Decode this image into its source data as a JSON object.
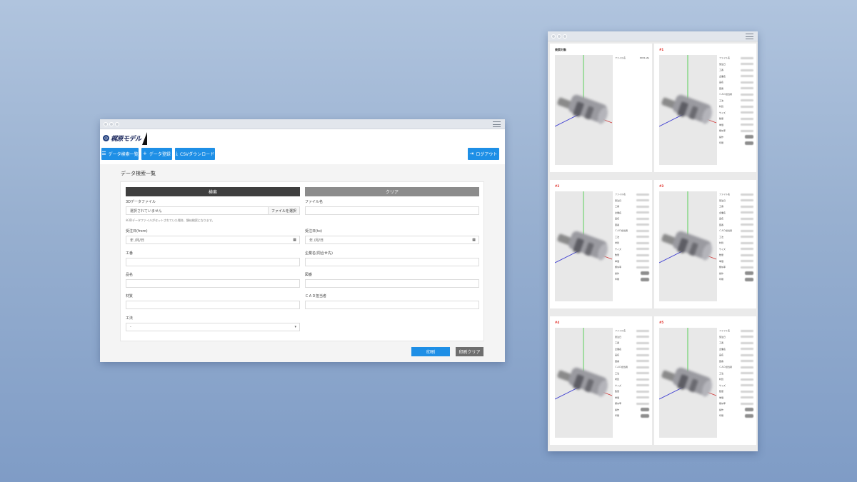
{
  "left_window": {
    "logo_text": "梶原モデル",
    "nav": {
      "list_label": "データ検索一覧",
      "register_label": "データ登録",
      "csv_label": "CSVダウンロード",
      "logout_label": "ログアウト"
    },
    "page_title": "データ検索一覧",
    "search_label": "検索",
    "clear_label": "クリア",
    "fields": {
      "data3d_label": "3Dデータファイル",
      "file_placeholder": "選択されていません",
      "file_button": "ファイルを選択",
      "file_hint": "※3Dデータファイルがセットされていた場合、類似検索になります。",
      "filename_label": "ファイル名",
      "order_date_label": "受注日(from)",
      "order_date_value": "年 /月/日",
      "order_date_to_label": "受注日(to)",
      "order_date_to_value": "年 /月/日",
      "worker_label": "工番",
      "company_label": "企業名(問合せ先)",
      "product_label": "品名",
      "drawing_label": "図番",
      "material_label": "材質",
      "cad_label": "ＣＡＤ担当者",
      "process_label": "工法",
      "process_value": "-"
    },
    "print_label": "印刷",
    "print_clear_label": "印刷クリア"
  },
  "right_window": {
    "cards": [
      {
        "title": "検索対象",
        "red": false,
        "prop_key": "ファイル名",
        "prop_value": "0001.stp"
      },
      {
        "title": "#1",
        "red": true
      },
      {
        "title": "#2",
        "red": true
      },
      {
        "title": "#3",
        "red": true
      },
      {
        "title": "#4",
        "red": true
      },
      {
        "title": "#5",
        "red": true
      }
    ],
    "prop_labels": [
      "ファイル名",
      "受注日",
      "工番",
      "企業名",
      "品名",
      "図番",
      "ＣＡＤ担当者",
      "工法",
      "材質",
      "サイズ",
      "数量",
      "単価",
      "類似率",
      "操作",
      "印刷"
    ]
  },
  "icons": [
    "list-icon",
    "plus-icon",
    "download-icon",
    "logout-icon",
    "calendar-icon",
    "chevron-down-icon",
    "hamburger-icon"
  ],
  "colors": {
    "primary": "#1e8fe6",
    "search_dark": "#3f3f3f",
    "clear_gray": "#8c8c8c",
    "rank_red": "#e0302a"
  }
}
